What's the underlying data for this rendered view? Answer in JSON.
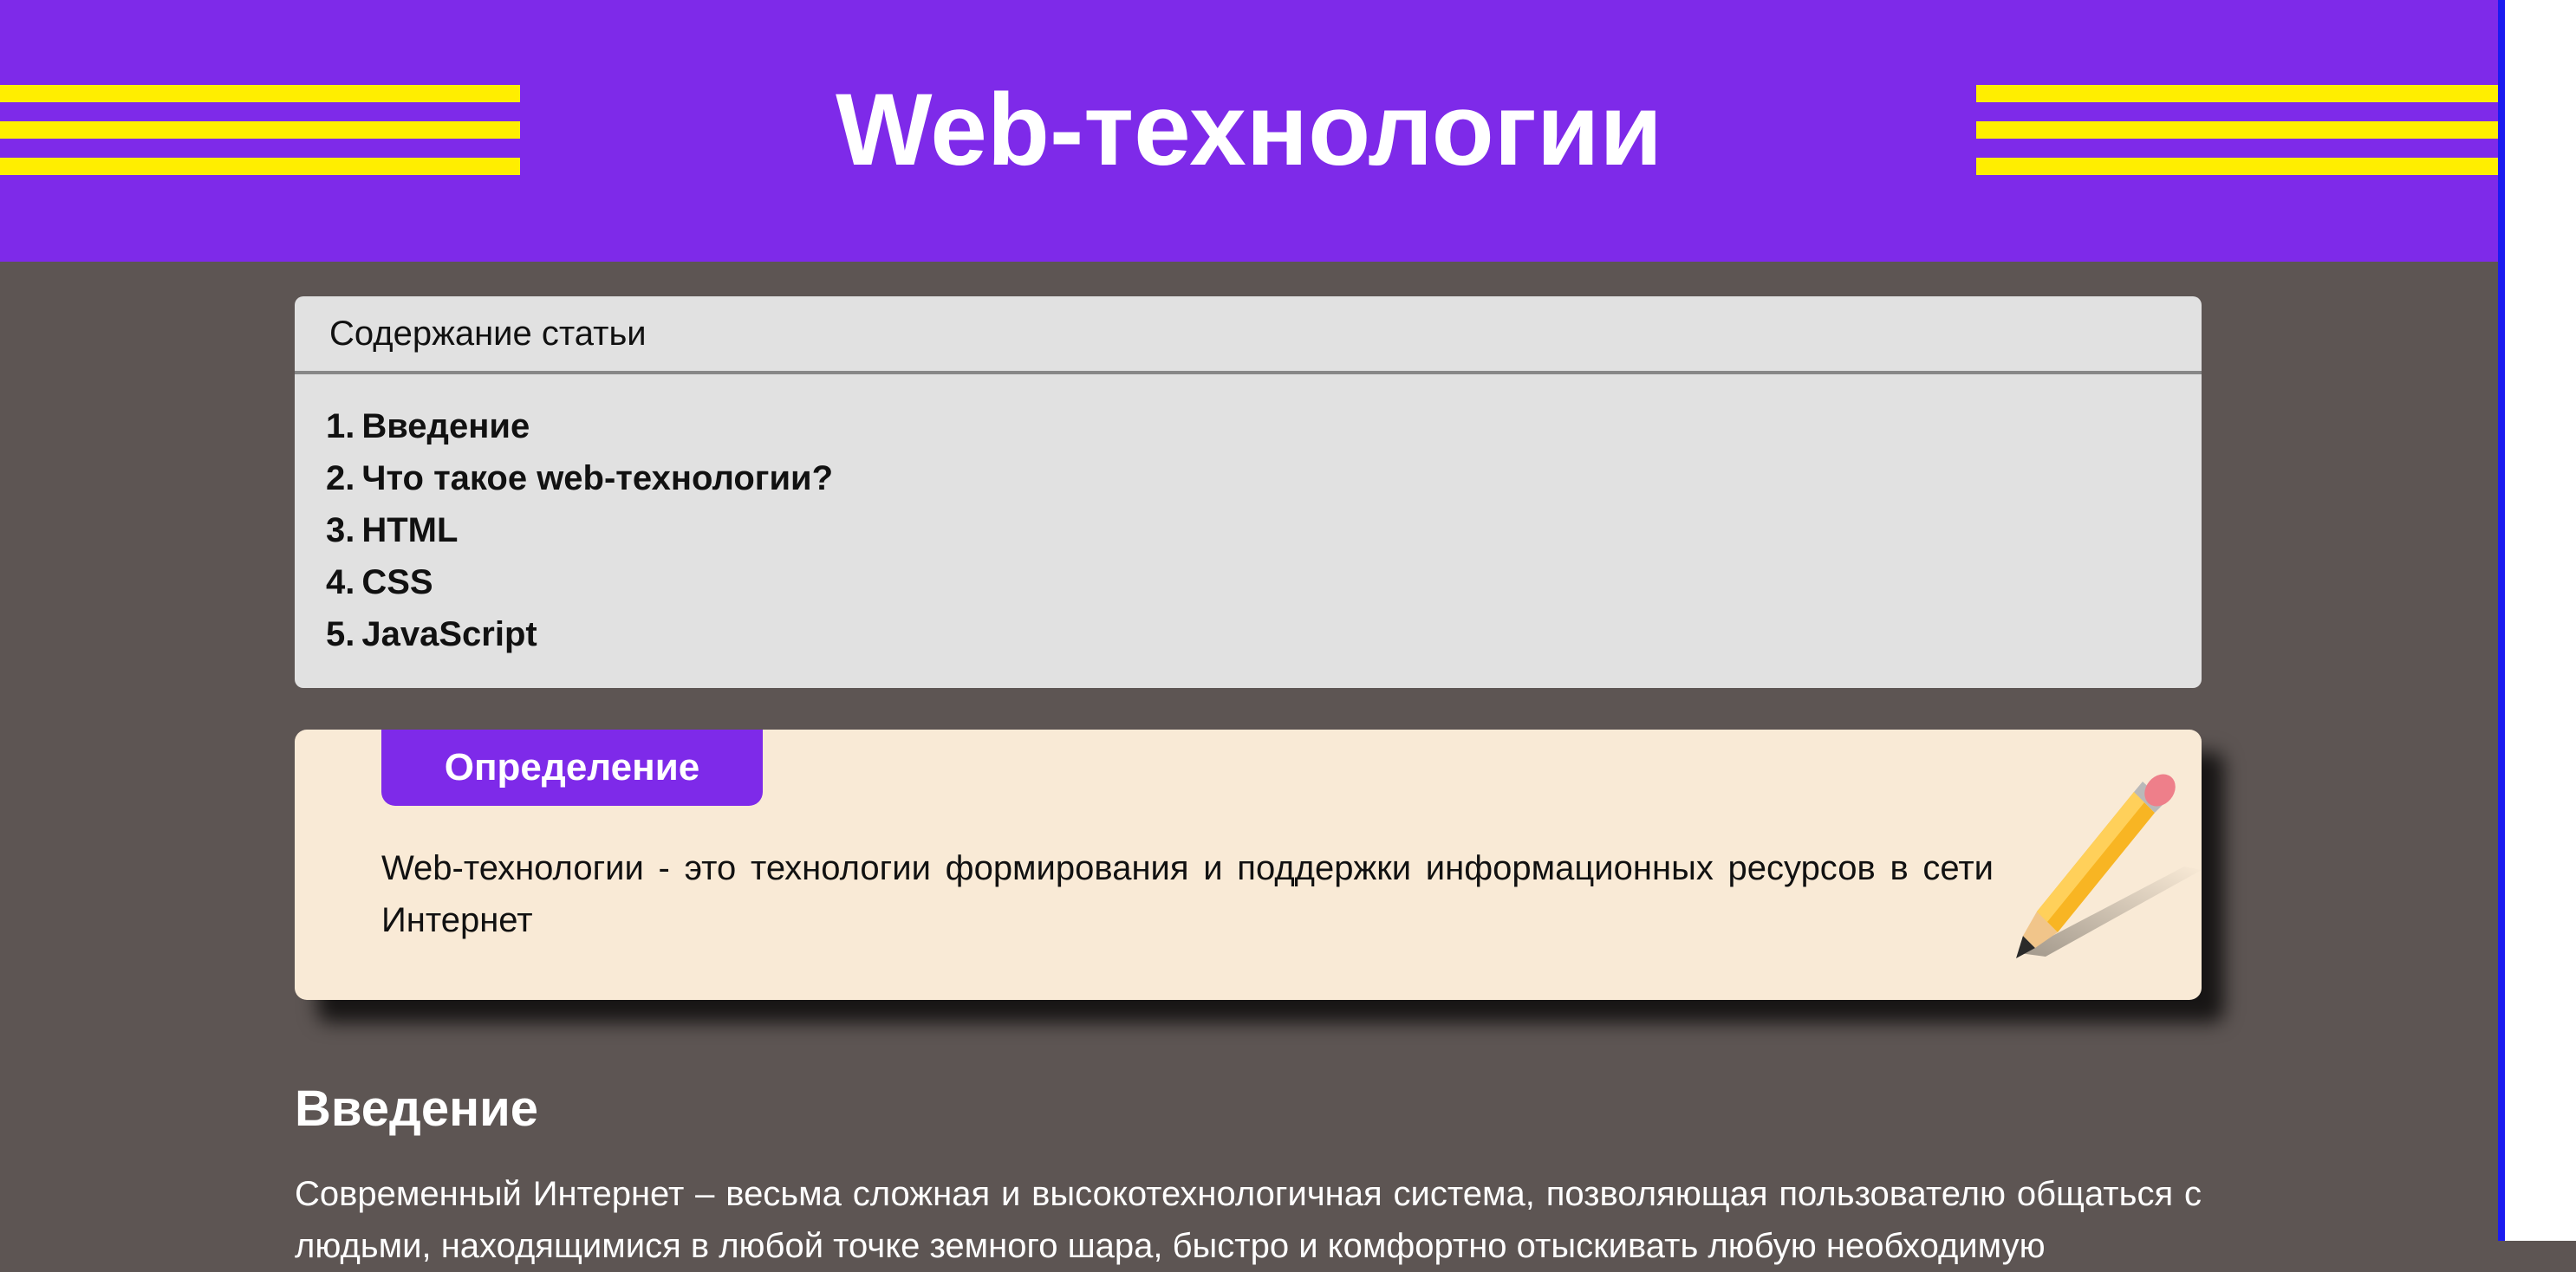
{
  "header": {
    "title": "Web-технологии",
    "stripe_color": "#ffee00",
    "background": "#7e2ae9"
  },
  "toc": {
    "title": "Содержание статьи",
    "items": [
      {
        "num": "1.",
        "label": "Введение"
      },
      {
        "num": "2.",
        "label": "Что такое web-технологии?"
      },
      {
        "num": "3.",
        "label": "HTML"
      },
      {
        "num": "4.",
        "label": "CSS"
      },
      {
        "num": "5.",
        "label": "JavaScript"
      }
    ]
  },
  "definition": {
    "tab_label": "Определение",
    "text": "Web-технологии - это технологии формирования и поддержки информационных ресурсов в сети Интернет",
    "icon": "pencil-icon"
  },
  "section": {
    "title": "Введение",
    "text": "Современный Интернет – весьма сложная и высокотехнологичная система, позволяющая пользователю общаться с людьми, находящимися в любой точке земного шара, быстро и комфортно отыскивать любую необходимую"
  },
  "colors": {
    "page_background": "#5d5553",
    "toc_background": "#e1e1e1",
    "definition_background": "#f9ead6",
    "accent": "#7e2ae9"
  }
}
